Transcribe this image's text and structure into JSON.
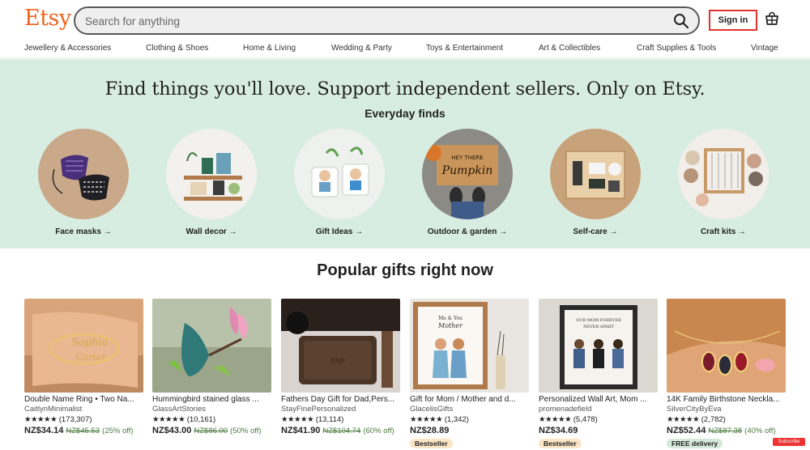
{
  "header": {
    "logo": "Etsy",
    "search_placeholder": "Search for anything",
    "signin_label": "Sign in"
  },
  "categories": [
    "Jewellery & Accessories",
    "Clothing & Shoes",
    "Home & Living",
    "Wedding & Party",
    "Toys & Entertainment",
    "Art & Collectibles",
    "Craft Supplies & Tools",
    "Vintage"
  ],
  "hero": {
    "title": "Find things you'll love. Support independent sellers. Only on Etsy.",
    "subtitle": "Everyday finds",
    "items": [
      {
        "label": "Face masks →"
      },
      {
        "label": "Wall decor →"
      },
      {
        "label": "Gift Ideas →"
      },
      {
        "label": "Outdoor & garden →"
      },
      {
        "label": "Self-care →"
      },
      {
        "label": "Craft kits →"
      }
    ]
  },
  "popular": {
    "title": "Popular gifts right now",
    "products": [
      {
        "title": "Double Name Ring • Two Na...",
        "shop": "CaitlynMinimalist",
        "stars": "★★★★★",
        "reviews": "(173,307)",
        "price": "NZ$34.14",
        "orig": "NZ$45.53",
        "pct": "(25% off)",
        "badge": ""
      },
      {
        "title": "Hummingbird stained glass ...",
        "shop": "GlassArtStories",
        "stars": "★★★★★",
        "reviews": "(10,161)",
        "price": "NZ$43.00",
        "orig": "NZ$86.00",
        "pct": "(50% off)",
        "badge": ""
      },
      {
        "title": "Fathers Day Gift for Dad,Pers...",
        "shop": "StayFinePersonalized",
        "stars": "★★★★★",
        "reviews": "(13,114)",
        "price": "NZ$41.90",
        "orig": "NZ$104.74",
        "pct": "(60% off)",
        "badge": ""
      },
      {
        "title": "Gift for Mom / Mother and d...",
        "shop": "GlacelisGifts",
        "stars": "★★★★★",
        "reviews": "(1,342)",
        "price": "NZ$28.89",
        "orig": "",
        "pct": "",
        "badge": "Bestseller"
      },
      {
        "title": "Personalized Wall Art, Mom ...",
        "shop": "promenadefield",
        "stars": "★★★★★",
        "reviews": "(5,478)",
        "price": "NZ$34.69",
        "orig": "",
        "pct": "",
        "badge": "Bestseller"
      },
      {
        "title": "14K Family Birthstone Neckla...",
        "shop": "SilverCityByEva",
        "stars": "★★★★★",
        "reviews": "(2,782)",
        "price": "NZ$52.44",
        "orig": "NZ$87.38",
        "pct": "(40% off)",
        "badge": "FREE delivery"
      }
    ]
  },
  "colors": {
    "brand": "#f1641e",
    "hero_bg": "#d8ede2",
    "signin_border": "#e0332f",
    "discount": "#4b7a3f"
  },
  "overlay": {
    "subscribe": "Subscribe"
  }
}
